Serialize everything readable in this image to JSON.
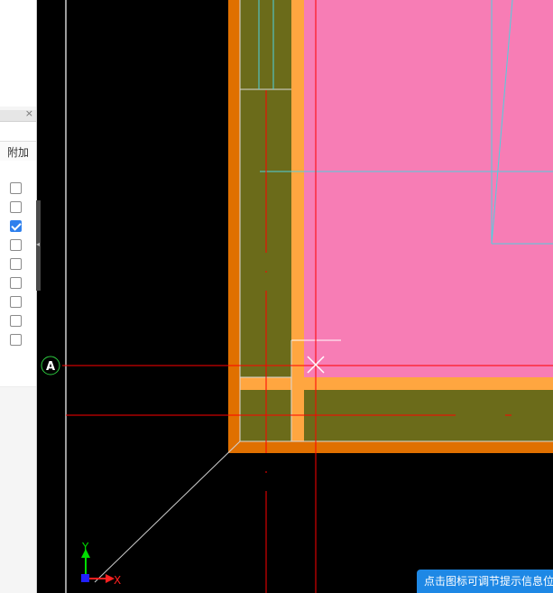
{
  "properties_panel": {
    "column_header": "附加",
    "close_label": "×",
    "checkboxes": [
      false,
      false,
      true,
      false,
      false,
      false,
      false,
      false,
      false
    ]
  },
  "canvas": {
    "grid_axis_label": "A",
    "ucs_y_label": "Y",
    "ucs_x_label": "X"
  },
  "hint_bar": {
    "text": "点击图标可调节提示信息位"
  },
  "colors": {
    "background": "#000000",
    "slab_fill": "#f77db5",
    "beam_fill": "#6b6b1a",
    "wall_outline": "#e07000",
    "beam_edge": "#ffa640",
    "axis_line": "#ff0000",
    "cyan_line": "#4fd0e0",
    "hint_bar": "#1e88e5"
  }
}
